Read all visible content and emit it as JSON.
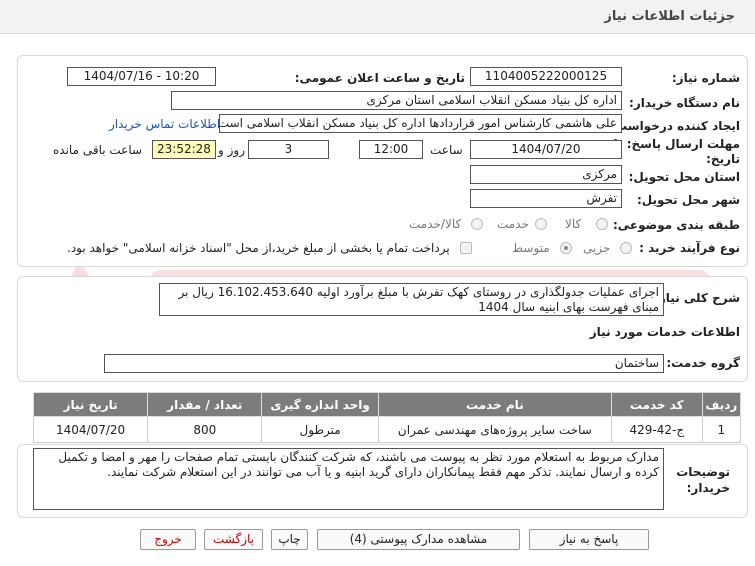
{
  "header": {
    "title": "جزئیات اطلاعات نیاز"
  },
  "info": {
    "need_number_label": "شماره نیاز:",
    "need_number": "1104005222000125",
    "announce_label": "تاریخ و ساعت اعلان عمومی:",
    "announce_value": "1404/07/16 - 10:20",
    "buyer_org_label": "نام دستگاه خریدار:",
    "buyer_org": "اداره کل بنیاد مسکن انقلاب اسلامی استان مرکزی",
    "creator_label": "ایجاد کننده درخواست:",
    "creator": "علی هاشمی کارشناس امور قراردادها اداره کل بنیاد مسکن انقلاب اسلامی است",
    "contact_link": "اطلاعات تماس خریدار",
    "deadline_label_1": "مهلت ارسال پاسخ: تا",
    "deadline_label_2": "تاریخ:",
    "deadline_date": "1404/07/20",
    "time_label": "ساعت",
    "deadline_time": "12:00",
    "days_value": "3",
    "days_label": "روز و",
    "remaining_time": "23:52:28",
    "remaining_label": "ساعت باقی مانده",
    "province_label": "استان محل تحویل:",
    "province": "مرکزی",
    "city_label": "شهر محل تحویل:",
    "city": "تفرش",
    "category_label": "طبقه بندی موضوعی:",
    "category_options": [
      "کالا",
      "خدمت",
      "کالا/خدمت"
    ],
    "process_label": "نوع فرآیند خرید :",
    "process_options": [
      "جزیی",
      "متوسط"
    ],
    "payment_note": "پرداخت تمام یا بخشی از مبلغ خرید،از محل \"اسناد خزانه اسلامی\" خواهد بود."
  },
  "summary": {
    "label": "شرح کلی نیاز:",
    "text": "اجرای عملیات جدولگذاری در روستای کهک تفرش با مبلغ برآورد اولیه  16.102.453.640 ریال بر مبنای فهرست بهای ابنیه سال 1404"
  },
  "services": {
    "section_title": "اطلاعات خدمات مورد نیاز",
    "group_label": "گروه خدمت:",
    "group_value": "ساختمان",
    "table": {
      "headers": [
        "ردیف",
        "کد خدمت",
        "نام خدمت",
        "واحد اندازه گیری",
        "تعداد / مقدار",
        "تاریخ نیاز"
      ],
      "rows": [
        [
          "1",
          "ج-42-429",
          "ساخت سایر پروژه‌های مهندسی عمران",
          "مترطول",
          "800",
          "1404/07/20"
        ]
      ]
    }
  },
  "buyer_notes": {
    "label_1": "توضیحات",
    "label_2": "خریدار:",
    "text": "مدارک مربوط به استعلام مورد نظر به پیوست می باشند، که شرکت کنندگان بایستی تمام صفحات را مهر و امضا و تکمیل کرده و ارسال نمایند. تذکر مهم فقط پیمانکاران دارای گرید ابنیه و یا آب می توانند در این استعلام شرکت نمایند."
  },
  "buttons": {
    "reply": "پاسخ به نیاز",
    "attachments": "مشاهده مدارک پیوستی (4)",
    "print": "چاپ",
    "back": "بازگشت",
    "exit": "خروج"
  }
}
